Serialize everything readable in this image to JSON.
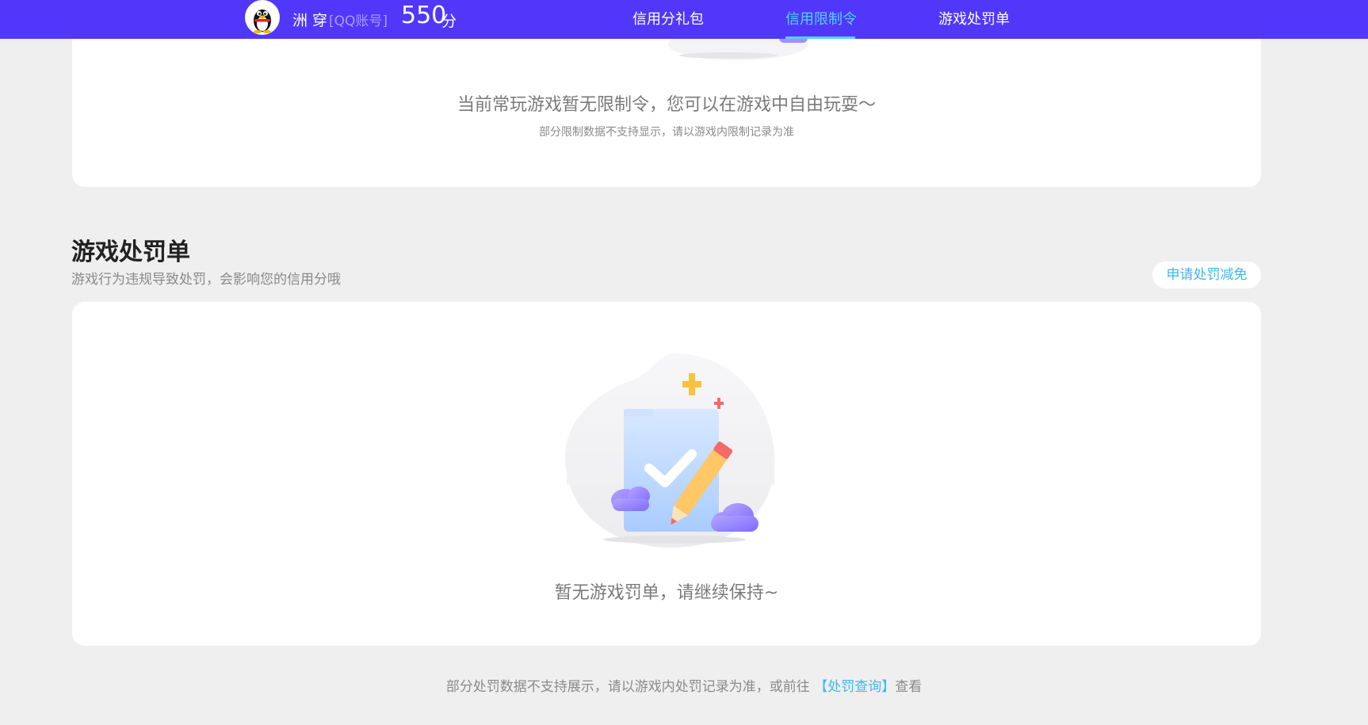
{
  "header": {
    "nickname": "洲 穿",
    "account_type": "[QQ账号]",
    "score": "550",
    "score_unit": "分",
    "nav": [
      {
        "label": "信用分礼包",
        "active": false
      },
      {
        "label": "信用限制令",
        "active": true
      },
      {
        "label": "游戏处罚单",
        "active": false
      }
    ]
  },
  "restriction_card": {
    "message": "当前常玩游戏暂无限制令，您可以在游戏中自由玩耍～",
    "note": "部分限制数据不支持显示，请以游戏内限制记录为准"
  },
  "penalty_section": {
    "title": "游戏处罚单",
    "description": "游戏行为违规导致处罚，会影响您的信用分哦",
    "appeal_button": "申请处罚减免",
    "empty_message": "暂无游戏罚单，请继续保持~"
  },
  "footer": {
    "note_prefix": "部分处罚数据不支持展示，请以游戏内处罚记录为准，或前往",
    "link_label": "【处罚查询】",
    "note_suffix": "查看"
  },
  "colors": {
    "topbar": "#5137fa",
    "accent": "#4fd3ff",
    "link": "#3cb8f0",
    "page_bg": "#efefef"
  }
}
